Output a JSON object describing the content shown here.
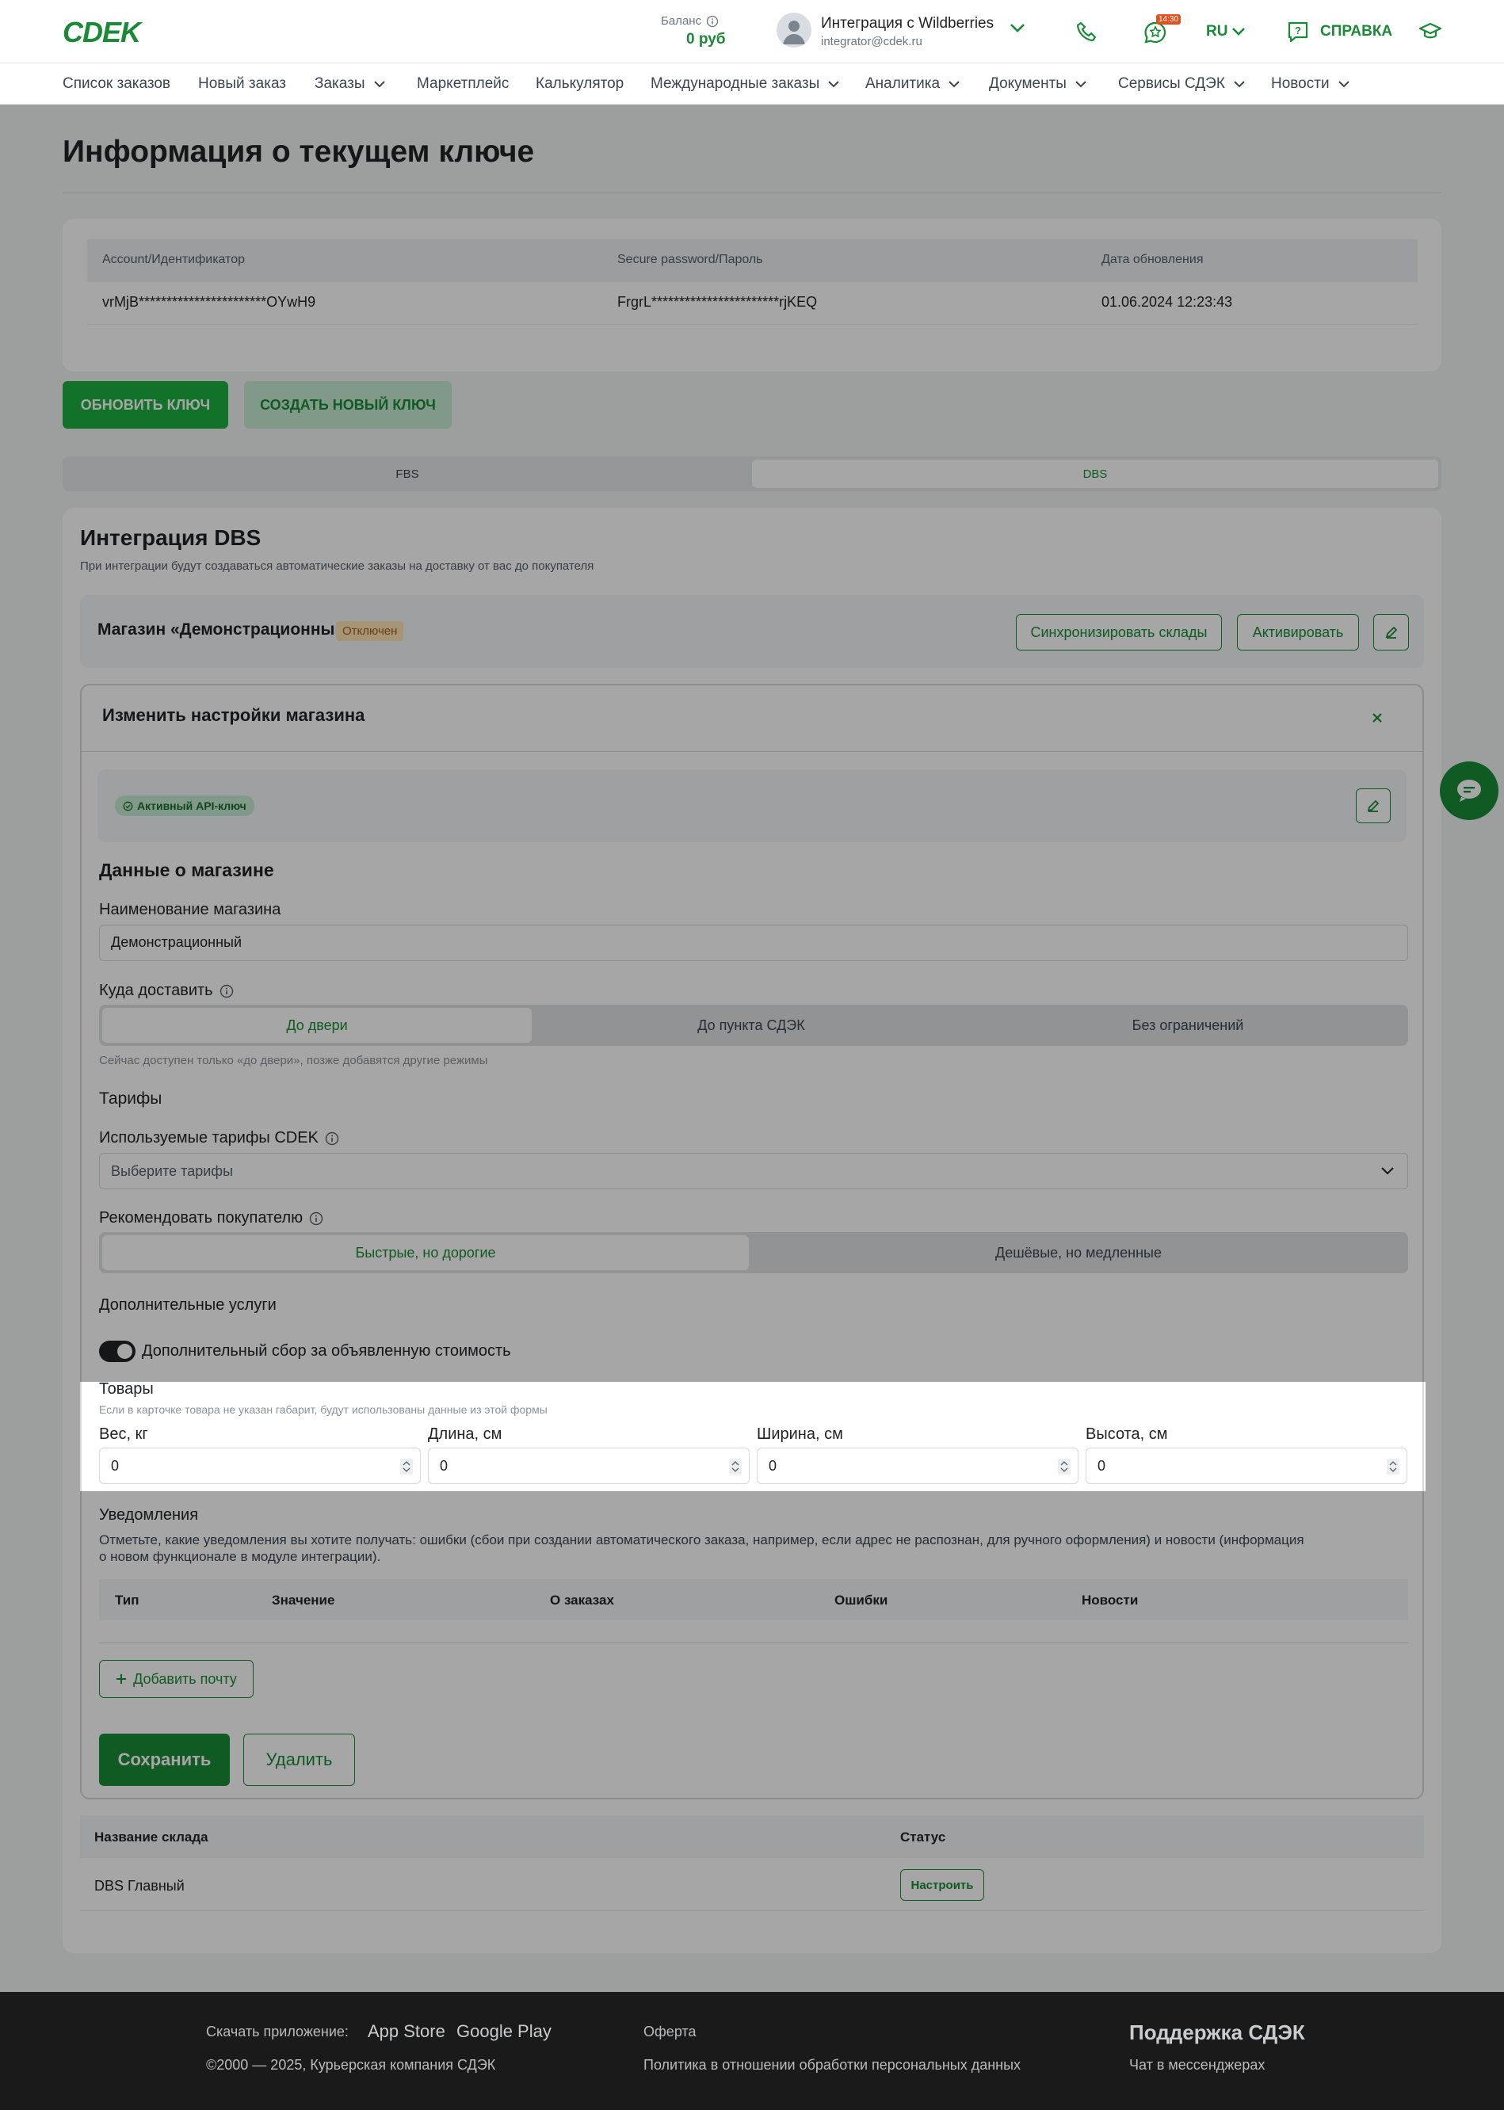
{
  "header": {
    "logo": "CDEK",
    "balance_label": "Баланс",
    "balance_value": "0 руб",
    "user_name": "Интеграция с Wildberries",
    "user_email": "integrator@cdek.ru",
    "chat_badge": "14:30",
    "lang": "RU",
    "help_label": "СПРАВКА"
  },
  "nav": {
    "items": [
      "Список заказов",
      "Новый заказ",
      "Заказы",
      "Маркетплейс",
      "Калькулятор",
      "Международные заказы",
      "Аналитика",
      "Документы",
      "Сервисы СДЭК",
      "Новости"
    ]
  },
  "page": {
    "title": "Информация о текущем ключе"
  },
  "key_table": {
    "headers": [
      "Account/Идентификатор",
      "Secure password/Пароль",
      "Дата обновления"
    ],
    "row": [
      "vrMjB***********************OYwH9",
      "FrgrL***********************rjKEQ",
      "01.06.2024 12:23:43"
    ]
  },
  "key_actions": {
    "refresh": "ОБНОВИТЬ КЛЮЧ",
    "create": "СОЗДАТЬ НОВЫЙ КЛЮЧ"
  },
  "mode_tabs": [
    "FBS",
    "DBS"
  ],
  "dbs": {
    "title": "Интеграция DBS",
    "subtitle": "При интеграции будут создаваться автоматические заказы на доставку от вас до покупателя"
  },
  "store": {
    "name": "Магазин «Демонстрационный»",
    "status": "Отключен",
    "sync_button": "Синхронизировать склады",
    "activate_button": "Активировать"
  },
  "settings": {
    "title": "Изменить настройки магазина",
    "api_badge": "Активный API-ключ",
    "store_data_title": "Данные о магазине",
    "store_name_label": "Наименование магазина",
    "store_name_value": "Демонстрационный",
    "deliver_label": "Куда доставить",
    "deliver_options": [
      "До двери",
      "До пункта СДЭК",
      "Без ограничений"
    ],
    "deliver_hint": "Сейчас доступен только «до двери», позже добавятся другие режимы",
    "tariffs_title": "Тарифы",
    "tariffs_label": "Используемые тарифы CDEK",
    "tariffs_placeholder": "Выберите тарифы",
    "recommend_label": "Рекомендовать покупателю",
    "recommend_options": [
      "Быстрые, но дорогие",
      "Дешёвые, но медленные"
    ],
    "extra_title": "Дополнительные услуги",
    "extra_toggle_label": "Дополнительный сбор за объявленную стоимость",
    "goods_title": "Товары",
    "goods_hint": "Если в карточке товара не указан габарит, будут использованы данные из этой формы",
    "dims": [
      {
        "label": "Вес, кг",
        "value": "0"
      },
      {
        "label": "Длина, см",
        "value": "0"
      },
      {
        "label": "Ширина, см",
        "value": "0"
      },
      {
        "label": "Высота, см",
        "value": "0"
      }
    ],
    "notif_title": "Уведомления",
    "notif_text_1": "Отметьте, какие уведомления вы хотите получать: ошибки (сбои при создании автоматического заказа, например, если адрес не распознан, для ручного оформления) и новости (информация",
    "notif_text_2": "о новом функционале в модуле интеграции).",
    "notif_headers": [
      "Тип",
      "Значение",
      "О заказах",
      "Ошибки",
      "Новости"
    ],
    "add_email": "Добавить почту",
    "save": "Сохранить",
    "delete": "Удалить"
  },
  "warehouses": {
    "headers": [
      "Название склада",
      "Статус"
    ],
    "row_name": "DBS Главный",
    "row_action": "Настроить"
  },
  "footer": {
    "download_label": "Скачать приложение:",
    "app_store": "App Store",
    "google_play": "Google Play",
    "copyright": "©2000 — 2025, Курьерская компания СДЭК",
    "offer": "Оферта",
    "privacy": "Политика в отношении обработки персональных данных",
    "support_title": "Поддержка СДЭК",
    "support_chat": "Чат в мессенджерах"
  },
  "colors": {
    "brand_green": "#1a8a36",
    "status_orange": "#f2a63b",
    "overlay": "rgba(0,0,0,0.35)"
  }
}
